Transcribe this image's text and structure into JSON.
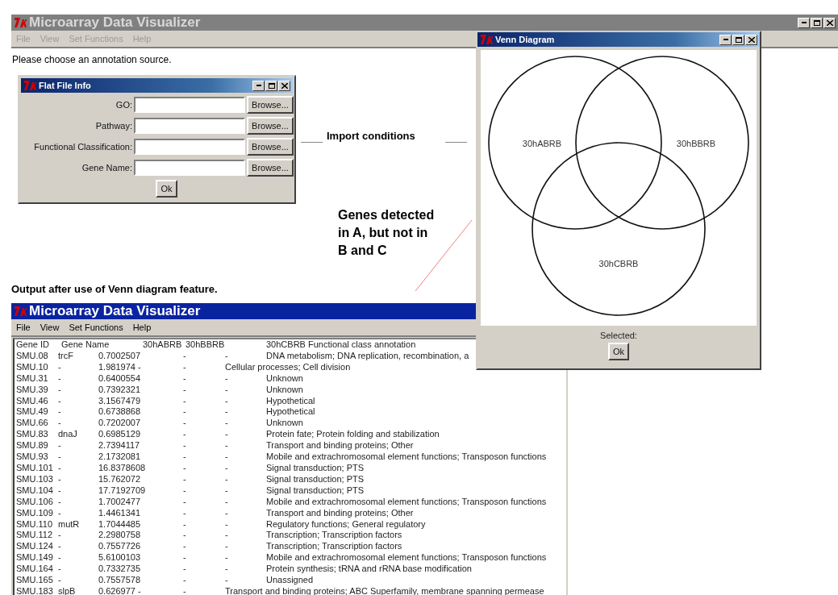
{
  "back_window": {
    "title": "Microarray Data Visualizer",
    "active": false,
    "menu": [
      "File",
      "View",
      "Set Functions",
      "Help"
    ],
    "message": "Please choose an annotation source."
  },
  "flat_file_dialog": {
    "title": "Flat File Info",
    "fields": [
      {
        "label": "GO:",
        "button": "Browse..."
      },
      {
        "label": "Pathway:",
        "button": "Browse..."
      },
      {
        "label": "Functional Classification:",
        "button": "Browse..."
      },
      {
        "label": "Gene Name:",
        "button": "Browse..."
      }
    ],
    "ok": "Ok"
  },
  "import_note": "Import conditions",
  "venn_note": [
    "Genes detected",
    "in A, but not in",
    "B and C"
  ],
  "output_note": "Output after use of Venn diagram feature.",
  "result_window": {
    "title": "Microarray Data Visualizer",
    "active": true,
    "menu": [
      "File",
      "View",
      "Set Functions",
      "Help"
    ],
    "table": {
      "header": [
        "Gene ID",
        "Gene Name",
        "30hABRB",
        "30hBBRB",
        "30hCBRB Functional class annotation"
      ],
      "rows": [
        {
          "kind": "aligned",
          "cells": [
            "SMU.08",
            "trcF",
            "0.7002507",
            "-",
            "-",
            "DNA metabolism; DNA replication, recombination, a"
          ]
        },
        {
          "kind": "shifted",
          "cells": [
            "SMU.10",
            "-",
            "1.981974 -",
            "-",
            "Cellular processes; Cell division"
          ]
        },
        {
          "kind": "aligned",
          "cells": [
            "SMU.31",
            "-",
            "0.6400554",
            "-",
            "-",
            "Unknown"
          ]
        },
        {
          "kind": "aligned",
          "cells": [
            "SMU.39",
            "-",
            "0.7392321",
            "-",
            "-",
            "Unknown"
          ]
        },
        {
          "kind": "aligned",
          "cells": [
            "SMU.46",
            "-",
            "3.1567479",
            "-",
            "-",
            "Hypothetical"
          ]
        },
        {
          "kind": "aligned",
          "cells": [
            "SMU.49",
            "-",
            "0.6738868",
            "-",
            "-",
            "Hypothetical"
          ]
        },
        {
          "kind": "aligned",
          "cells": [
            "SMU.66",
            "-",
            "0.7202007",
            "-",
            "-",
            "Unknown"
          ]
        },
        {
          "kind": "aligned",
          "cells": [
            "SMU.83",
            "dnaJ",
            "0.6985129",
            "-",
            "-",
            "Protein fate; Protein folding and stabilization"
          ]
        },
        {
          "kind": "aligned",
          "cells": [
            "SMU.89",
            "-",
            "2.7394117",
            "-",
            "-",
            "Transport and binding proteins; Other"
          ]
        },
        {
          "kind": "aligned",
          "cells": [
            "SMU.93",
            "-",
            "2.1732081",
            "-",
            "-",
            "Mobile and extrachromosomal element functions; Transposon functions"
          ]
        },
        {
          "kind": "aligned",
          "cells": [
            "SMU.101",
            "-",
            "16.8378608",
            "-",
            "-",
            "Signal transduction; PTS"
          ]
        },
        {
          "kind": "aligned",
          "cells": [
            "SMU.103",
            "-",
            "15.762072",
            "-",
            "-",
            "Signal transduction; PTS"
          ]
        },
        {
          "kind": "aligned",
          "cells": [
            "SMU.104",
            "-",
            "17.7192709",
            "-",
            "-",
            "Signal transduction; PTS"
          ]
        },
        {
          "kind": "aligned",
          "cells": [
            "SMU.106",
            "-",
            "1.7002477",
            "-",
            "-",
            "Mobile and extrachromosomal element functions; Transposon functions"
          ]
        },
        {
          "kind": "aligned",
          "cells": [
            "SMU.109",
            "-",
            "1.4461341",
            "-",
            "-",
            "Transport and binding proteins; Other"
          ]
        },
        {
          "kind": "aligned",
          "cells": [
            "SMU.110",
            "mutR",
            "1.7044485",
            "-",
            "-",
            "Regulatory functions; General regulatory"
          ]
        },
        {
          "kind": "aligned",
          "cells": [
            "SMU.112",
            "-",
            "2.2980758",
            "-",
            "-",
            "Transcription; Transcription factors"
          ]
        },
        {
          "kind": "aligned",
          "cells": [
            "SMU.124",
            "-",
            "0.7557726",
            "-",
            "-",
            "Transcription; Transcription factors"
          ]
        },
        {
          "kind": "aligned",
          "cells": [
            "SMU.149",
            "-",
            "5.6100103",
            "-",
            "-",
            "Mobile and extrachromosomal element functions; Transposon functions"
          ]
        },
        {
          "kind": "aligned",
          "cells": [
            "SMU.164",
            "-",
            "0.7332735",
            "-",
            "-",
            "Protein synthesis; tRNA and rRNA base modification"
          ]
        },
        {
          "kind": "aligned",
          "cells": [
            "SMU.165",
            "-",
            "0.7557578",
            "-",
            "-",
            "Unassigned"
          ]
        },
        {
          "kind": "shifted",
          "cells": [
            "SMU.183",
            "slpB",
            "0.626977 -",
            "-",
            "Transport and binding proteins; ABC Superfamily, membrane spanning permease"
          ]
        }
      ]
    }
  },
  "venn_window": {
    "title": "Venn Diagram",
    "active": true,
    "sets": [
      "30hABRB",
      "30hBBRB",
      "30hCBRB"
    ],
    "status": "Selected:",
    "ok": "Ok"
  }
}
